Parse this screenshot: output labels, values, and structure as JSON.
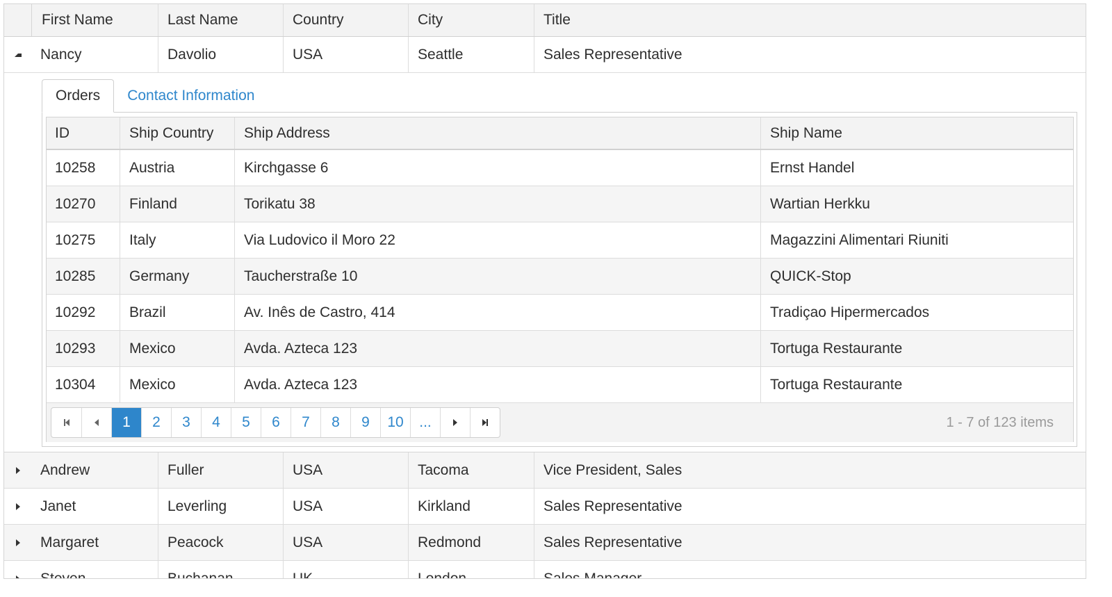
{
  "grid": {
    "columns": [
      "First Name",
      "Last Name",
      "Country",
      "City",
      "Title"
    ],
    "expanded_row": {
      "first": "Nancy",
      "last": "Davolio",
      "country": "USA",
      "city": "Seattle",
      "title": "Sales Representative"
    },
    "rows": [
      {
        "first": "Andrew",
        "last": "Fuller",
        "country": "USA",
        "city": "Tacoma",
        "title": "Vice President, Sales"
      },
      {
        "first": "Janet",
        "last": "Leverling",
        "country": "USA",
        "city": "Kirkland",
        "title": "Sales Representative"
      },
      {
        "first": "Margaret",
        "last": "Peacock",
        "country": "USA",
        "city": "Redmond",
        "title": "Sales Representative"
      },
      {
        "first": "Steven",
        "last": "Buchanan",
        "country": "UK",
        "city": "London",
        "title": "Sales Manager"
      }
    ]
  },
  "detail": {
    "tabs": [
      "Orders",
      "Contact Information"
    ],
    "active_tab": "Orders",
    "columns": [
      "ID",
      "Ship Country",
      "Ship Address",
      "Ship Name"
    ],
    "orders": [
      {
        "id": "10258",
        "country": "Austria",
        "address": "Kirchgasse 6",
        "name": "Ernst Handel"
      },
      {
        "id": "10270",
        "country": "Finland",
        "address": "Torikatu 38",
        "name": "Wartian Herkku"
      },
      {
        "id": "10275",
        "country": "Italy",
        "address": "Via Ludovico il Moro 22",
        "name": "Magazzini Alimentari Riuniti"
      },
      {
        "id": "10285",
        "country": "Germany",
        "address": "Taucherstraße 10",
        "name": "QUICK-Stop"
      },
      {
        "id": "10292",
        "country": "Brazil",
        "address": "Av. Inês de Castro, 414",
        "name": "Tradiçao Hipermercados"
      },
      {
        "id": "10293",
        "country": "Mexico",
        "address": "Avda. Azteca 123",
        "name": "Tortuga Restaurante"
      },
      {
        "id": "10304",
        "country": "Mexico",
        "address": "Avda. Azteca 123",
        "name": "Tortuga Restaurante"
      }
    ],
    "pager": {
      "pages": [
        "1",
        "2",
        "3",
        "4",
        "5",
        "6",
        "7",
        "8",
        "9",
        "10",
        "..."
      ],
      "current": "1",
      "info": "1 - 7 of 123 items",
      "icons": {
        "first": "first-page-icon",
        "prev": "previous-page-icon",
        "next": "next-page-icon",
        "last": "last-page-icon"
      }
    }
  },
  "colors": {
    "accent": "#2e86cb",
    "link": "#2f87cc",
    "header_bg": "#f3f3f3",
    "border": "#d5d5d5",
    "info_text": "#9a9a9a"
  }
}
